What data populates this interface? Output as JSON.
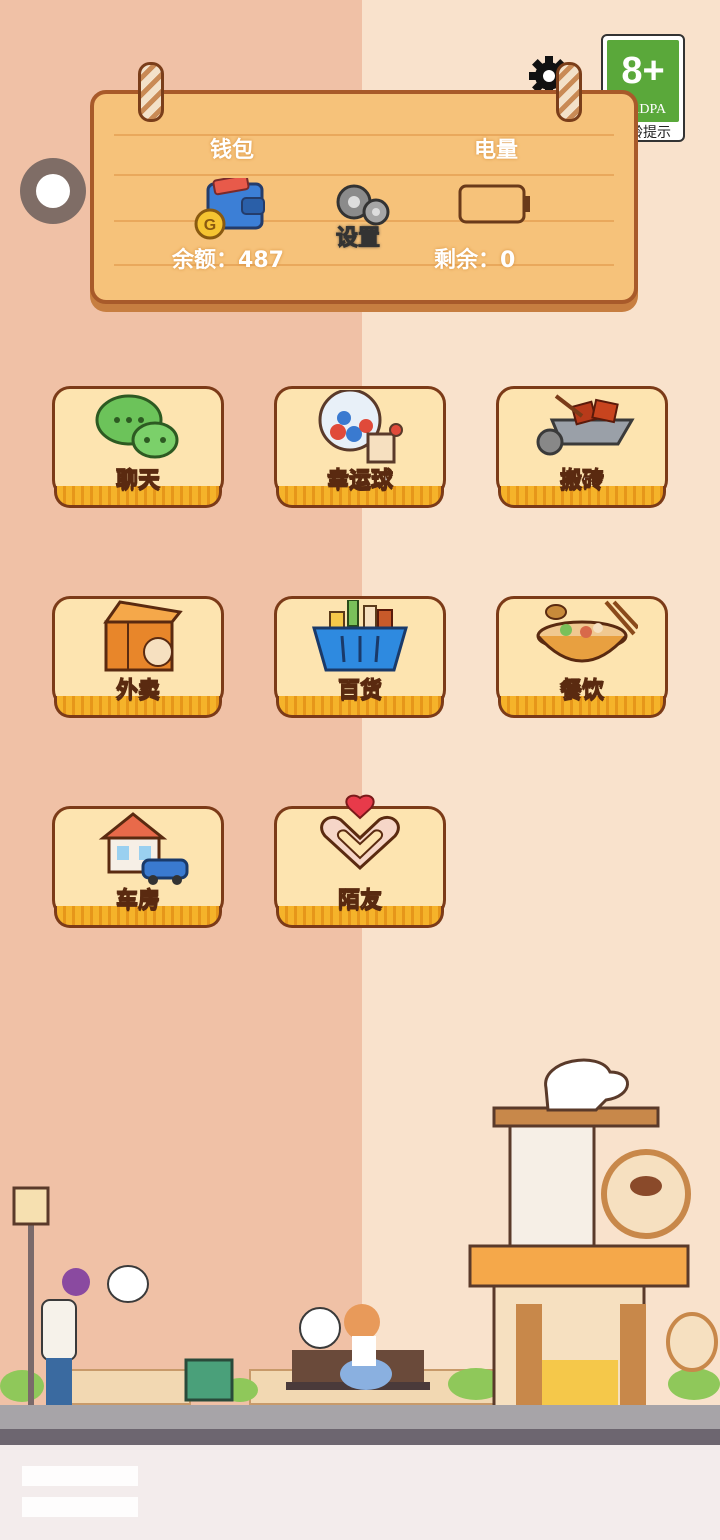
{
  "age_rating": {
    "number": "8+",
    "org": "CADPA",
    "tip": "适龄提示"
  },
  "sign": {
    "wallet_label": "钱包",
    "battery_label": "电量",
    "settings_label": "设置",
    "balance_label": "余额：",
    "balance_value": "487",
    "remaining_label": "剩余：",
    "remaining_value": "0"
  },
  "apps": [
    {
      "label": "聊天",
      "icon": "chat-icon"
    },
    {
      "label": "幸运球",
      "icon": "lottery-ball-icon"
    },
    {
      "label": "搬砖",
      "icon": "wheelbarrow-icon"
    },
    {
      "label": "外卖",
      "icon": "delivery-box-icon"
    },
    {
      "label": "百货",
      "icon": "shopping-basket-icon"
    },
    {
      "label": "餐饮",
      "icon": "food-bowl-icon"
    },
    {
      "label": "车房",
      "icon": "house-car-icon"
    },
    {
      "label": "陌友",
      "icon": "heart-hands-icon"
    }
  ],
  "colors": {
    "bg_left": "#f0c1a6",
    "bg_right": "#f9e2cc",
    "sign": "#f6c27a",
    "tile": "#fde4b0",
    "border": "#7c3b18"
  }
}
